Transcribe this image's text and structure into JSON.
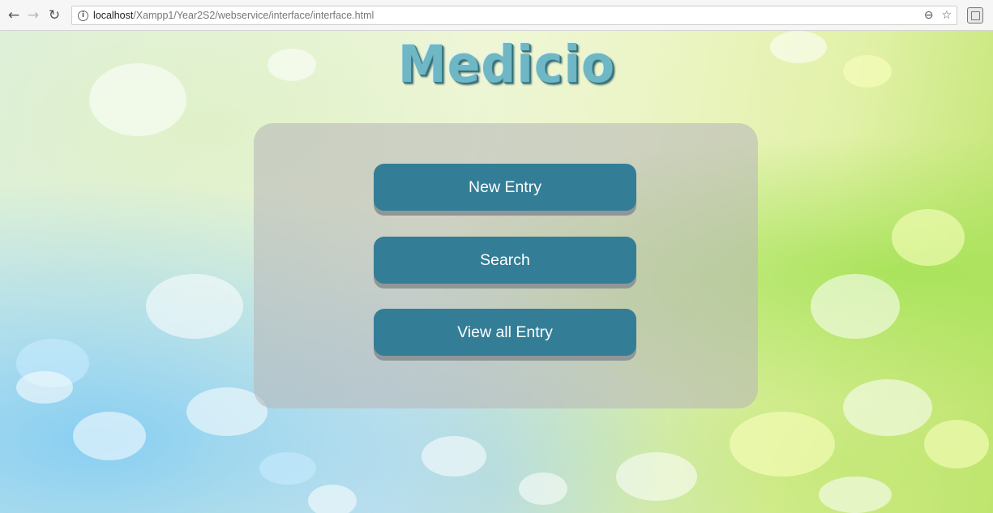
{
  "browser": {
    "url_host": "localhost",
    "url_path": "/Xampp1/Year2S2/webservice/interface/interface.html",
    "icons": {
      "back": "arrow-left-icon",
      "forward": "arrow-right-icon",
      "reload": "reload-icon",
      "info": "info-icon",
      "zoom": "zoom-out-icon",
      "bookmark": "star-icon",
      "extension": "extension-icon"
    }
  },
  "page": {
    "logo_text": "Medicio",
    "buttons": {
      "new_entry": "New Entry",
      "search": "Search",
      "view_all": "View all Entry"
    },
    "colors": {
      "button": "#347d96",
      "button_shadow": "#8f9698",
      "panel": "#b9b9b9"
    }
  }
}
